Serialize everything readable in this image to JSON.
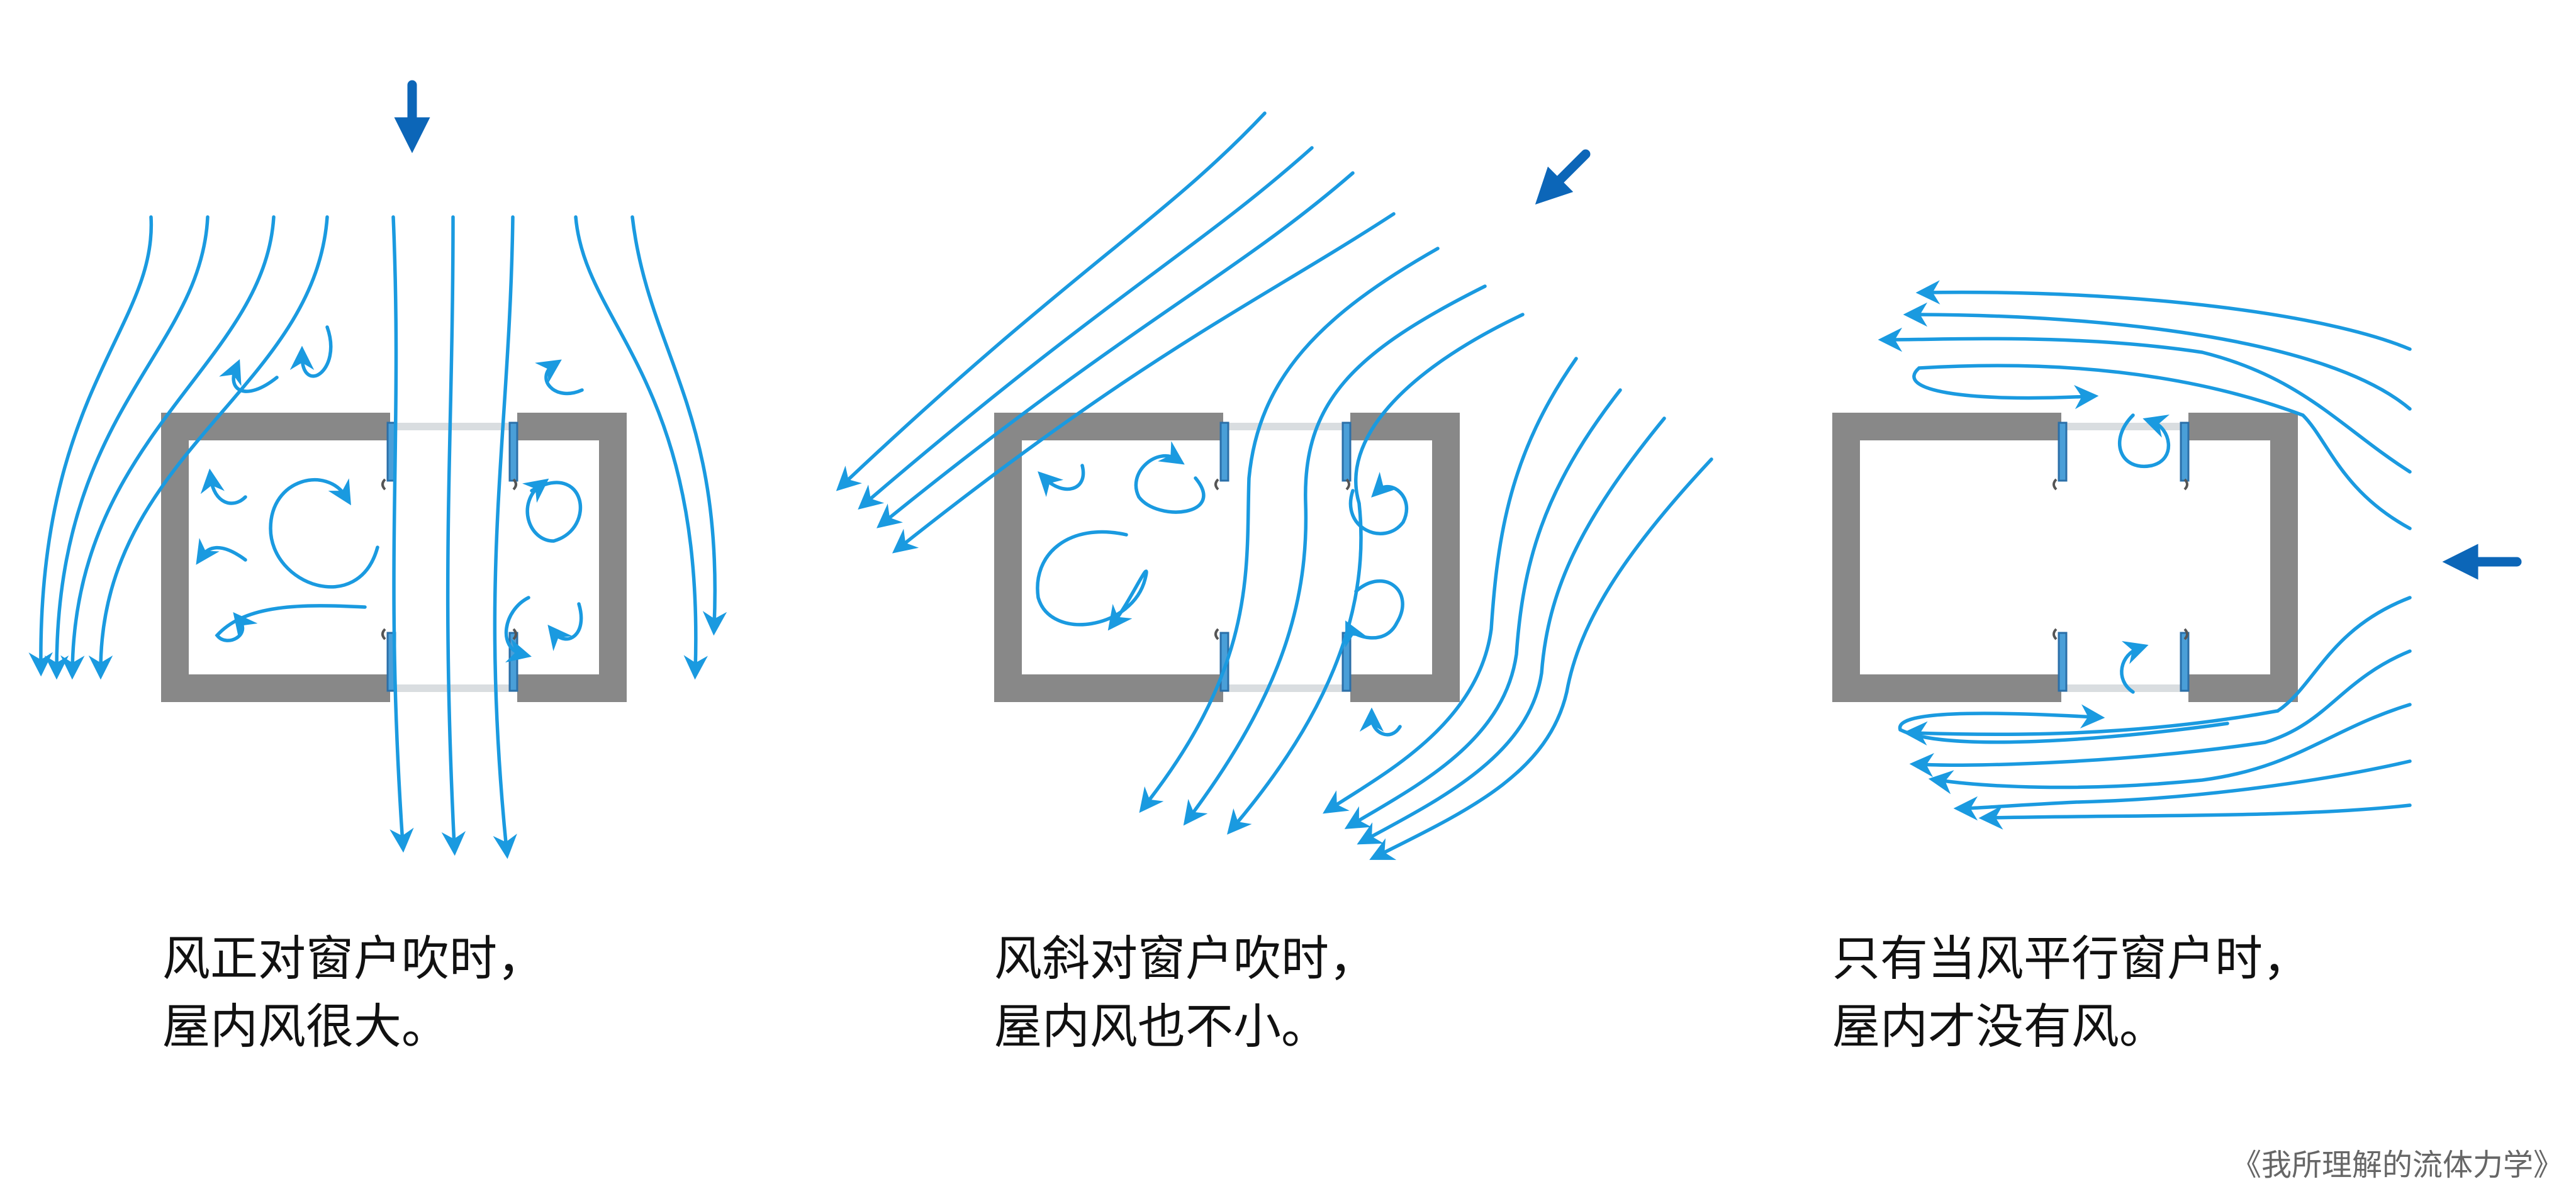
{
  "panels": [
    {
      "caption_line1": "风正对窗户吹时，",
      "caption_line2": "屋内风很大。"
    },
    {
      "caption_line1": "风斜对窗户吹时，",
      "caption_line2": "屋内风也不小。"
    },
    {
      "caption_line1": "只有当风平行窗户时，",
      "caption_line2": "屋内才没有风。"
    }
  ],
  "source": "《我所理解的流体力学》",
  "colors": {
    "flow": "#1a9ae0",
    "wind_arrow": "#0c66b8",
    "wall": "#888888"
  },
  "icons": {
    "wind": "wind-direction-arrow-icon",
    "flow": "streamline-arrow-icon"
  }
}
